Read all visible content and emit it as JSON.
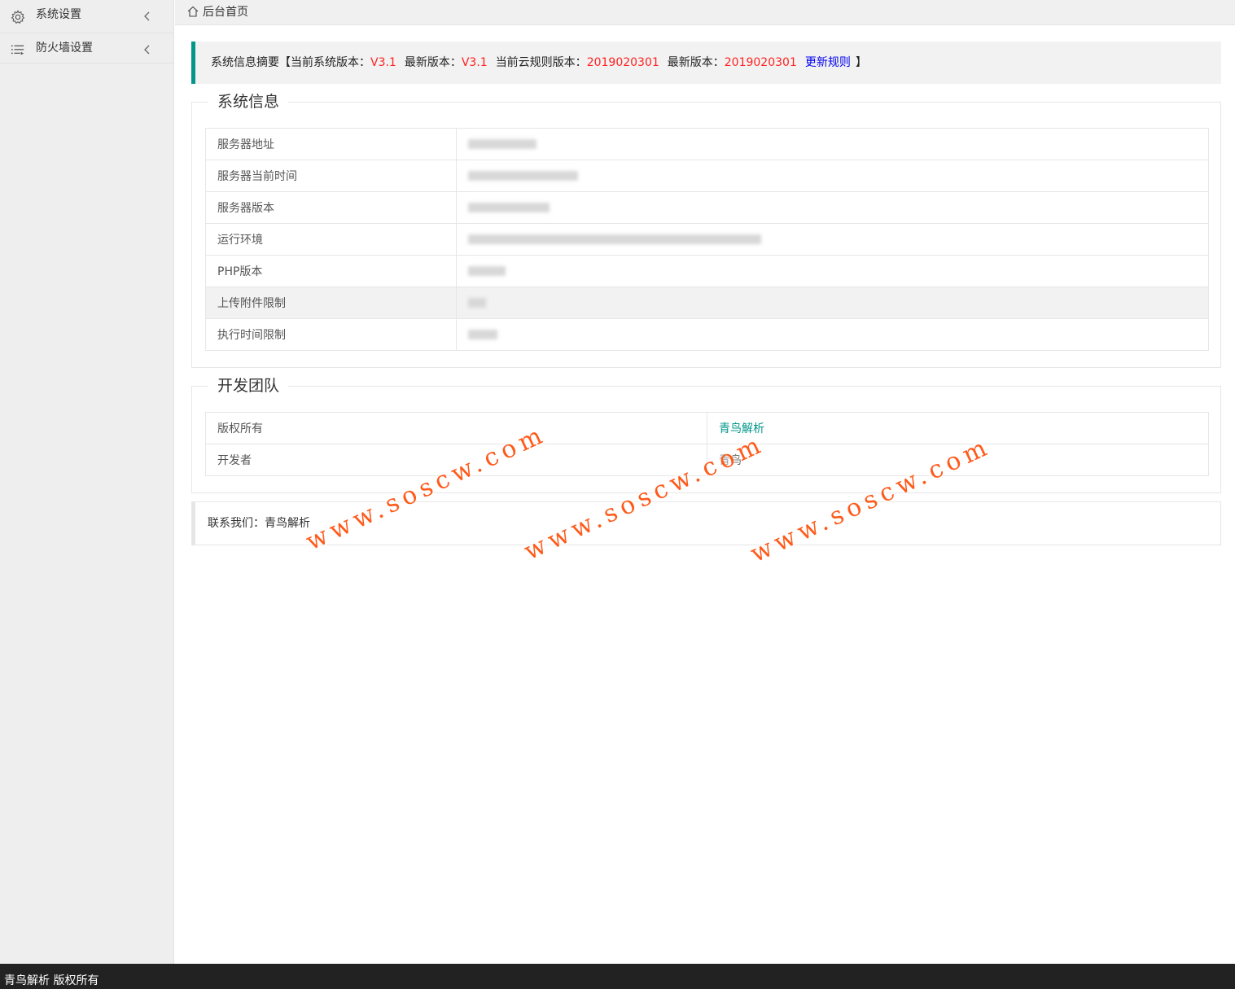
{
  "sidebar": {
    "items": [
      {
        "label": "系统设置",
        "icon": "gear-icon"
      },
      {
        "label": "防火墙设置",
        "icon": "list-icon"
      }
    ]
  },
  "topbar": {
    "breadcrumb": "后台首页",
    "icon": "home-icon"
  },
  "summary": {
    "prefix": "系统信息摘要【当前系统版本：",
    "current_version": "V3.1",
    "latest_label": "最新版本：",
    "latest_version": "V3.1",
    "cloud_label": "当前云规则版本：",
    "cloud_version": "2019020301",
    "cloud_latest_label": "最新版本：",
    "cloud_latest_version": "2019020301",
    "update_link": "更新规则",
    "suffix": "】"
  },
  "system_info": {
    "title": "系统信息",
    "rows": [
      {
        "label": "服务器地址"
      },
      {
        "label": "服务器当前时间"
      },
      {
        "label": "服务器版本"
      },
      {
        "label": "运行环境"
      },
      {
        "label": "PHP版本"
      },
      {
        "label": "上传附件限制"
      },
      {
        "label": "执行时间限制"
      }
    ]
  },
  "dev_team": {
    "title": "开发团队",
    "rows": [
      {
        "label": "版权所有",
        "value": "青鸟解析"
      },
      {
        "label": "开发者",
        "value": "青鸟"
      }
    ]
  },
  "contact": {
    "text": "联系我们：青鸟解析"
  },
  "watermark": {
    "text": "www.soscw.com"
  },
  "footer": {
    "text": "青鸟解析 版权所有"
  },
  "colors": {
    "accent": "#009688",
    "red": "#ff2222",
    "link": "#0000ee",
    "footer_bg": "#222222",
    "watermark": "#ff5a1a"
  }
}
